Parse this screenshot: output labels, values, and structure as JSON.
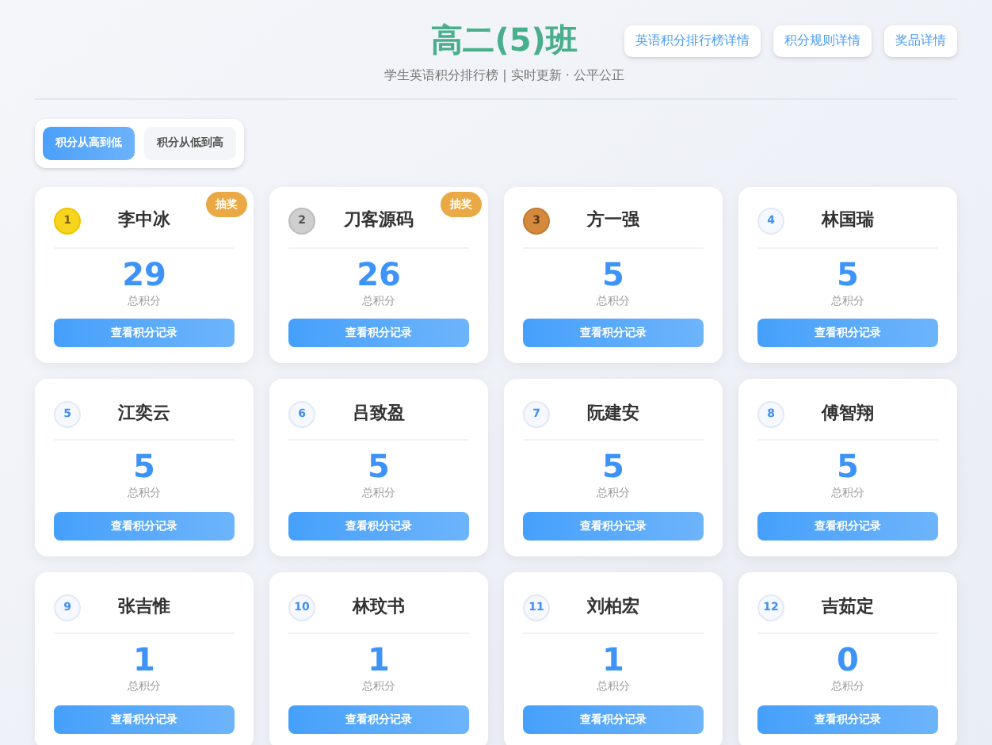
{
  "header": {
    "title": "高二(5)班",
    "subtitle": "学生英语积分排行榜 | 实时更新 · 公平公正",
    "links": [
      "英语积分排行榜详情",
      "积分规则详情",
      "奖品详情"
    ]
  },
  "sort_options": [
    {
      "label": "积分从高到低",
      "selected": true
    },
    {
      "label": "积分从低到高",
      "selected": false
    }
  ],
  "students": [
    {
      "rank": "1",
      "kind": "gold",
      "name": "李中冰",
      "score": "29",
      "score_label": "总积分",
      "tag": "抽奖",
      "button": "查看积分记录"
    },
    {
      "rank": "2",
      "kind": "silver",
      "name": "刀客源码",
      "score": "26",
      "score_label": "总积分",
      "tag": "抽奖",
      "button": "查看积分记录"
    },
    {
      "rank": "3",
      "kind": "bronze",
      "name": "方一强",
      "score": "5",
      "score_label": "总积分",
      "button": "查看积分记录"
    },
    {
      "rank": "4",
      "kind": "plain",
      "name": "林国瑞",
      "score": "5",
      "score_label": "总积分",
      "button": "查看积分记录"
    },
    {
      "rank": "5",
      "kind": "plain",
      "name": "江奕云",
      "score": "5",
      "score_label": "总积分",
      "button": "查看积分记录"
    },
    {
      "rank": "6",
      "kind": "plain",
      "name": "吕致盈",
      "score": "5",
      "score_label": "总积分",
      "button": "查看积分记录"
    },
    {
      "rank": "7",
      "kind": "plain",
      "name": "阮建安",
      "score": "5",
      "score_label": "总积分",
      "button": "查看积分记录"
    },
    {
      "rank": "8",
      "kind": "plain",
      "name": "傅智翔",
      "score": "5",
      "score_label": "总积分",
      "button": "查看积分记录"
    },
    {
      "rank": "9",
      "kind": "plain",
      "name": "张吉惟",
      "score": "1",
      "score_label": "总积分",
      "button": "查看积分记录"
    },
    {
      "rank": "10",
      "kind": "plain",
      "name": "林玟书",
      "score": "1",
      "score_label": "总积分",
      "button": "查看积分记录"
    },
    {
      "rank": "11",
      "kind": "plain",
      "name": "刘柏宏",
      "score": "1",
      "score_label": "总积分",
      "button": "查看积分记录"
    },
    {
      "rank": "12",
      "kind": "plain",
      "name": "吉茹定",
      "score": "0",
      "score_label": "总积分",
      "button": "查看积分记录"
    }
  ]
}
